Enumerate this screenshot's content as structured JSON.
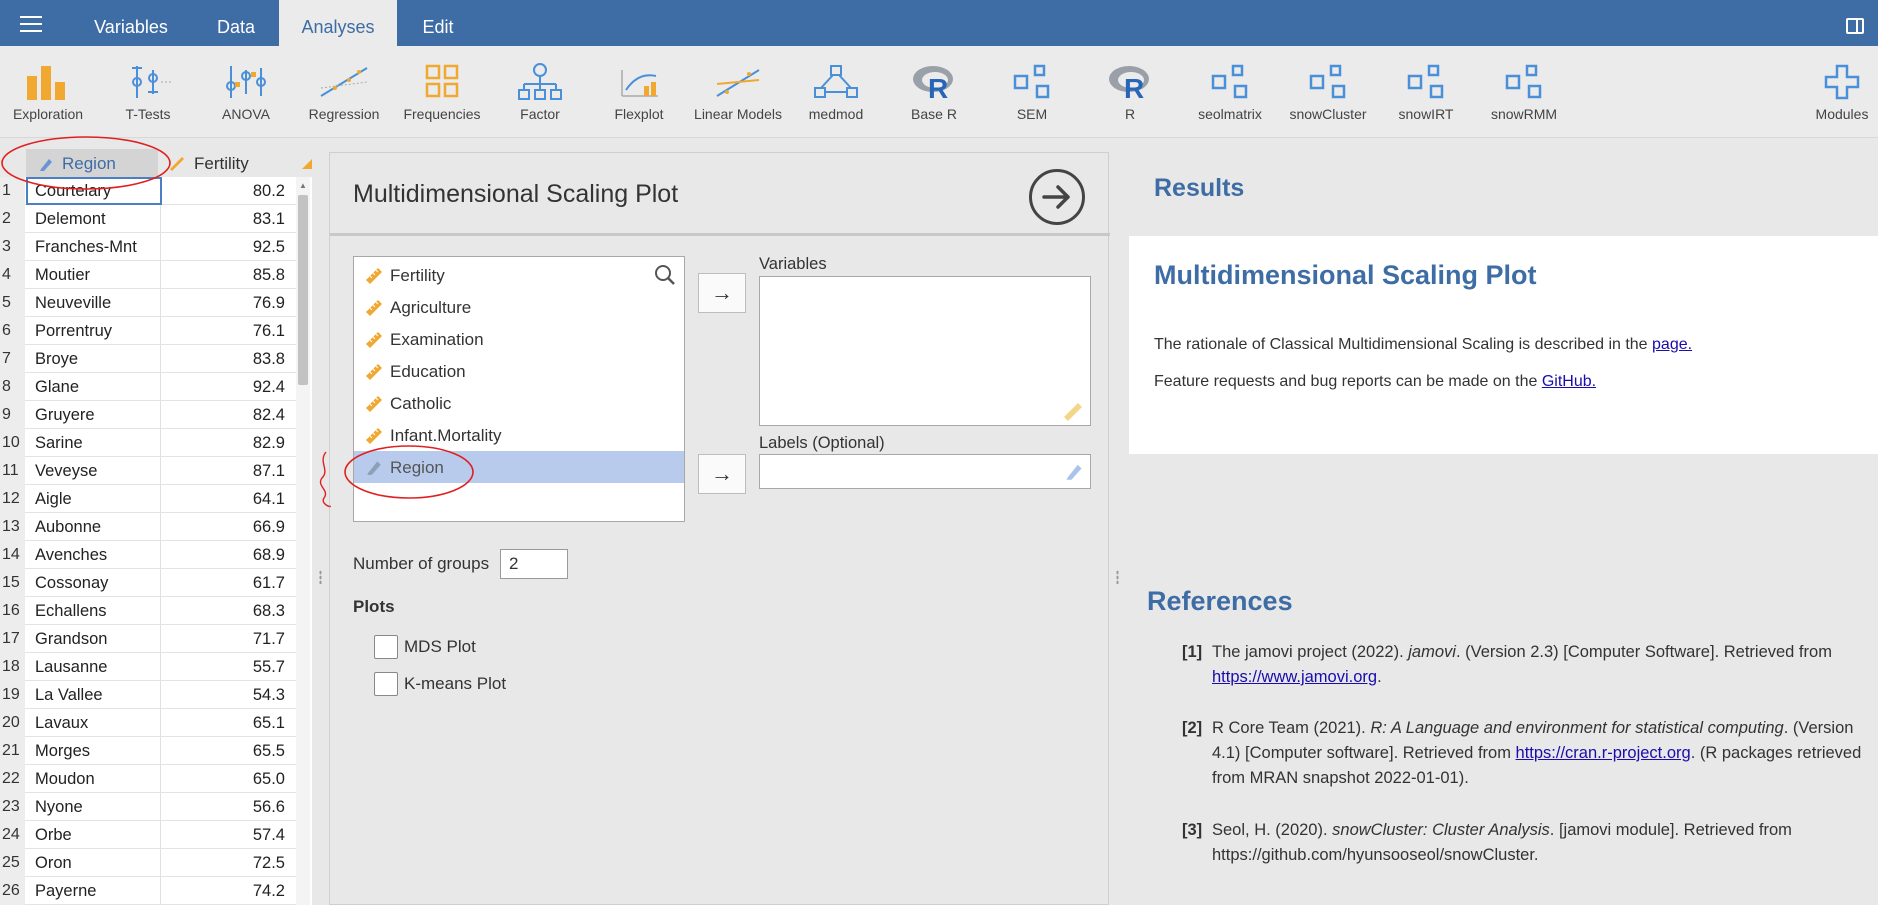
{
  "menu": {
    "tabs": [
      "Variables",
      "Data",
      "Analyses",
      "Edit"
    ],
    "active_tab": "Analyses"
  },
  "ribbon": {
    "buttons": [
      {
        "label": "Exploration",
        "icon": "exploration-icon"
      },
      {
        "label": "T-Tests",
        "icon": "t-tests-icon"
      },
      {
        "label": "ANOVA",
        "icon": "anova-icon"
      },
      {
        "label": "Regression",
        "icon": "regression-icon"
      },
      {
        "label": "Frequencies",
        "icon": "frequencies-icon"
      },
      {
        "label": "Factor",
        "icon": "factor-icon"
      },
      {
        "label": "Flexplot",
        "icon": "flexplot-icon"
      },
      {
        "label": "Linear Models",
        "icon": "linear-models-icon"
      },
      {
        "label": "medmod",
        "icon": "medmod-icon"
      },
      {
        "label": "Base R",
        "icon": "r-logo-icon"
      },
      {
        "label": "SEM",
        "icon": "module-squares-icon"
      },
      {
        "label": "R",
        "icon": "r-logo-icon"
      },
      {
        "label": "seolmatrix",
        "icon": "module-squares-icon"
      },
      {
        "label": "snowCluster",
        "icon": "module-squares-icon"
      },
      {
        "label": "snowIRT",
        "icon": "module-squares-icon"
      },
      {
        "label": "snowRMM",
        "icon": "module-squares-icon"
      },
      {
        "label": "Modules",
        "icon": "plus-icon"
      }
    ]
  },
  "spreadsheet": {
    "columns": [
      "Region",
      "Fertility"
    ],
    "rows": [
      {
        "n": "1",
        "region": "Courtelary",
        "fertility": "80.2"
      },
      {
        "n": "2",
        "region": "Delemont",
        "fertility": "83.1"
      },
      {
        "n": "3",
        "region": "Franches-Mnt",
        "fertility": "92.5"
      },
      {
        "n": "4",
        "region": "Moutier",
        "fertility": "85.8"
      },
      {
        "n": "5",
        "region": "Neuveville",
        "fertility": "76.9"
      },
      {
        "n": "6",
        "region": "Porrentruy",
        "fertility": "76.1"
      },
      {
        "n": "7",
        "region": "Broye",
        "fertility": "83.8"
      },
      {
        "n": "8",
        "region": "Glane",
        "fertility": "92.4"
      },
      {
        "n": "9",
        "region": "Gruyere",
        "fertility": "82.4"
      },
      {
        "n": "10",
        "region": "Sarine",
        "fertility": "82.9"
      },
      {
        "n": "11",
        "region": "Veveyse",
        "fertility": "87.1"
      },
      {
        "n": "12",
        "region": "Aigle",
        "fertility": "64.1"
      },
      {
        "n": "13",
        "region": "Aubonne",
        "fertility": "66.9"
      },
      {
        "n": "14",
        "region": "Avenches",
        "fertility": "68.9"
      },
      {
        "n": "15",
        "region": "Cossonay",
        "fertility": "61.7"
      },
      {
        "n": "16",
        "region": "Echallens",
        "fertility": "68.3"
      },
      {
        "n": "17",
        "region": "Grandson",
        "fertility": "71.7"
      },
      {
        "n": "18",
        "region": "Lausanne",
        "fertility": "55.7"
      },
      {
        "n": "19",
        "region": "La Vallee",
        "fertility": "54.3"
      },
      {
        "n": "20",
        "region": "Lavaux",
        "fertility": "65.1"
      },
      {
        "n": "21",
        "region": "Morges",
        "fertility": "65.5"
      },
      {
        "n": "22",
        "region": "Moudon",
        "fertility": "65.0"
      },
      {
        "n": "23",
        "region": "Nyone",
        "fertility": "56.6"
      },
      {
        "n": "24",
        "region": "Orbe",
        "fertility": "57.4"
      },
      {
        "n": "25",
        "region": "Oron",
        "fertility": "72.5"
      },
      {
        "n": "26",
        "region": "Payerne",
        "fertility": "74.2"
      }
    ]
  },
  "options": {
    "title": "Multidimensional Scaling Plot",
    "source_vars": [
      {
        "name": "Fertility",
        "type": "continuous"
      },
      {
        "name": "Agriculture",
        "type": "continuous"
      },
      {
        "name": "Examination",
        "type": "continuous"
      },
      {
        "name": "Education",
        "type": "continuous"
      },
      {
        "name": "Catholic",
        "type": "continuous"
      },
      {
        "name": "Infant.Mortality",
        "type": "continuous"
      },
      {
        "name": "Region",
        "type": "nominal",
        "selected": true
      }
    ],
    "variables_label": "Variables",
    "labels_label": "Labels (Optional)",
    "arrow": "→",
    "num_groups_label": "Number of groups",
    "num_groups_value": "2",
    "plots_heading": "Plots",
    "mds_plot_label": "MDS Plot",
    "kmeans_plot_label": "K-means Plot"
  },
  "results": {
    "heading": "Results",
    "title": "Multidimensional Scaling Plot",
    "p1_text": "The rationale of Classical Multidimensional Scaling is described in the ",
    "p1_link": "page.",
    "p2_text": "Feature requests and bug reports can be made on the ",
    "p2_link": "GitHub.",
    "references_heading": "References",
    "refs": [
      {
        "num": "[1]",
        "a": "The jamovi project (2022). ",
        "i": "jamovi",
        "b": ". (Version 2.3) [Computer Software]. Retrieved from ",
        "link": "https://www.jamovi.org",
        "c": "."
      },
      {
        "num": "[2]",
        "a": "R Core Team (2021). ",
        "i": "R: A Language and environment for statistical computing",
        "b": ". (Version 4.1) [Computer software]. Retrieved from ",
        "link": "https://cran.r-project.org",
        "c": ". (R packages retrieved from MRAN snapshot 2022-01-01)."
      },
      {
        "num": "[3]",
        "a": "Seol, H. (2020). ",
        "i": "snowCluster: Cluster Analysis",
        "b": ". [jamovi module]. Retrieved from https://github.com/hyunsooseol/snowCluster.",
        "link": "",
        "c": ""
      }
    ]
  },
  "colors": {
    "brand_blue": "#3e6ca5",
    "selected_row": "#b8cbed",
    "ruler_orange": "#f0a830",
    "annotation_red": "#e02020"
  }
}
